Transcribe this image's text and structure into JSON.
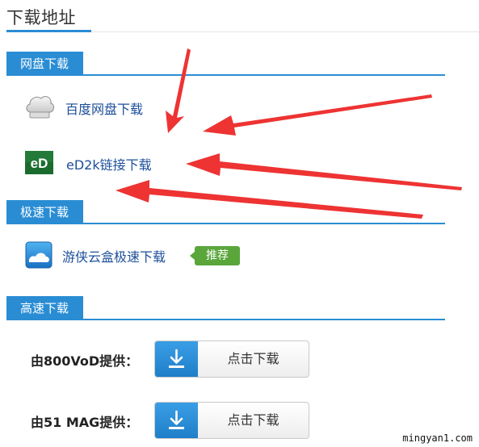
{
  "header": {
    "title": "下载地址"
  },
  "sections": [
    {
      "title": "网盘下载",
      "items": [
        {
          "label": "百度网盘下载",
          "icon": "cloud-icon"
        },
        {
          "label": "eD2k链接下载",
          "icon": "ed2k-icon",
          "icon_text": "eD"
        }
      ]
    },
    {
      "title": "极速下载",
      "items": [
        {
          "label": "游侠云盒极速下载",
          "icon": "youxia-cloudbox-icon",
          "badge": "推荐"
        }
      ]
    },
    {
      "title": "高速下载",
      "providers": [
        {
          "label": "由800VoD提供：",
          "button_label": "点击下载"
        },
        {
          "label": "由51 MAG提供：",
          "button_label": "点击下载"
        }
      ]
    }
  ],
  "watermark": "mingyan1.com",
  "colors": {
    "accent": "#2a8dd4",
    "link": "#1d4f99",
    "badge": "#5aa63b",
    "annotation_arrow": "#ee3333"
  }
}
